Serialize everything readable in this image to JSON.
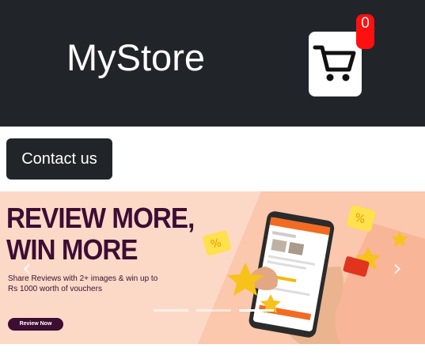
{
  "header": {
    "brand": "MyStore",
    "cart_count": "0"
  },
  "nav": {
    "contact_label": "Contact us"
  },
  "carousel": {
    "title_line1": "REVIEW MORE,",
    "title_line2": "WIN MORE",
    "subtitle": "Share Reviews with 2+ images & win up to Rs 1000 worth of vouchers",
    "button_label": "Review Now",
    "slide_count": 3,
    "active_slide": 3
  },
  "colors": {
    "header_bg": "#212529",
    "badge_bg": "#ff1010",
    "banner_bg": "#fcd6c3",
    "banner_text": "#3d0d33"
  }
}
